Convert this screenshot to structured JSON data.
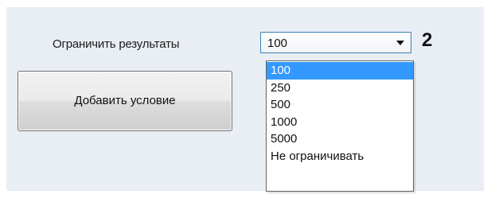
{
  "filter": {
    "limit_label": "Ограничить результаты",
    "limit_value": "100",
    "callout_number": "2",
    "add_condition_label": "Добавить условие"
  },
  "dropdown": {
    "selected_index": 0,
    "options": [
      "100",
      "250",
      "500",
      "1000",
      "5000",
      "Не ограничивать"
    ]
  },
  "colors": {
    "panel_background": "#e9eef5",
    "selection_highlight": "#3399ff",
    "combo_border": "#3c7fb1"
  },
  "icons": {
    "combo_arrow": "chevron-down-icon"
  }
}
